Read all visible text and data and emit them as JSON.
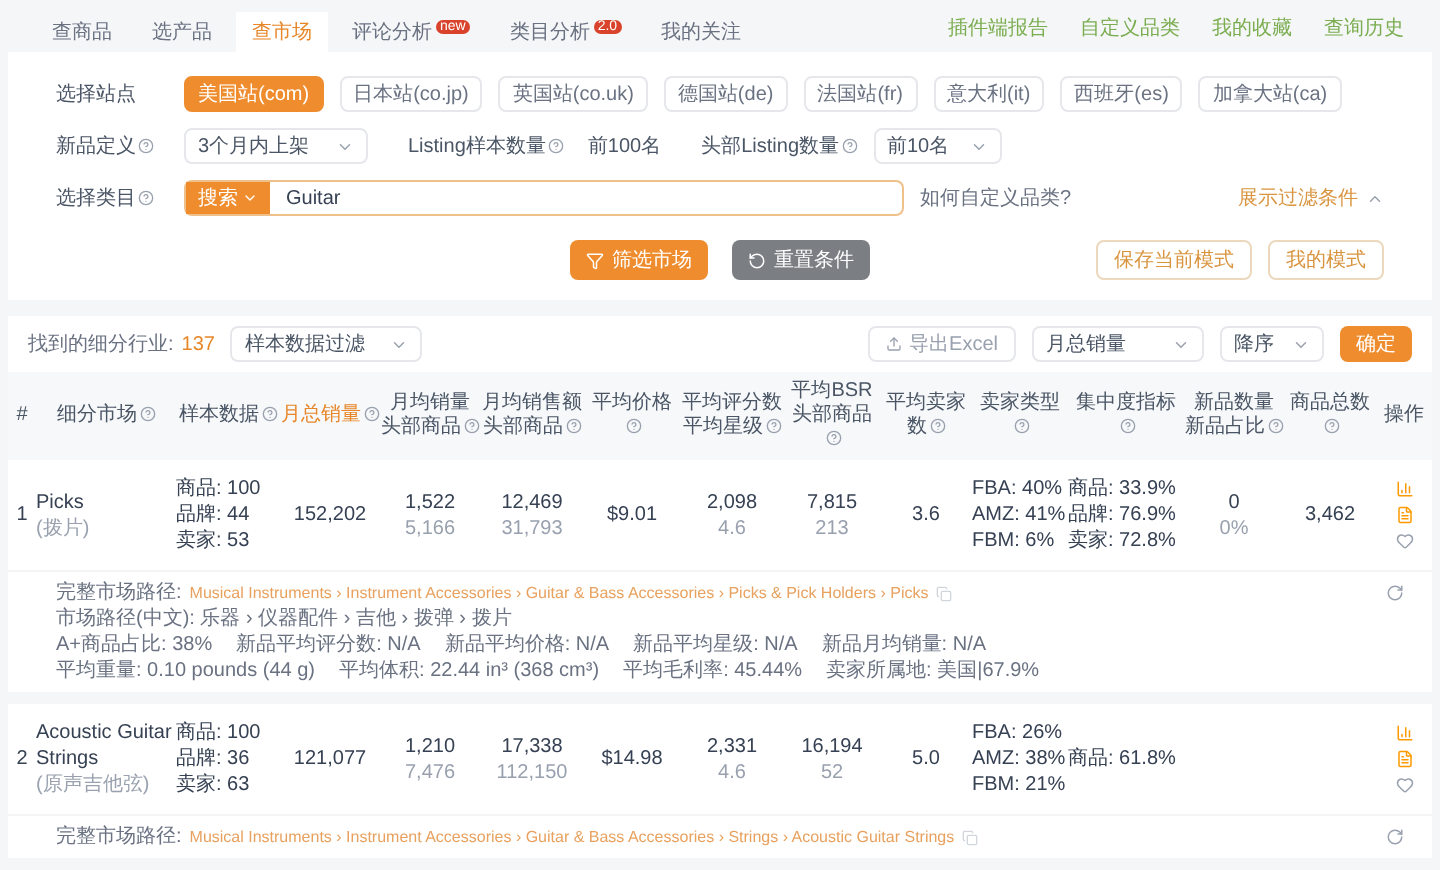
{
  "tabs": [
    {
      "label": "查商品",
      "selected": false
    },
    {
      "label": "选产品",
      "selected": false
    },
    {
      "label": "查市场",
      "selected": true
    },
    {
      "label": "评论分析",
      "selected": false,
      "badge": "new"
    },
    {
      "label": "类目分析",
      "selected": false,
      "badge": "2.0"
    },
    {
      "label": "我的关注",
      "selected": false
    }
  ],
  "top_links": [
    "插件端报告",
    "自定义品类",
    "我的收藏",
    "查询历史"
  ],
  "filters": {
    "site": {
      "label": "选择站点",
      "options": [
        {
          "label": "美国站(com)",
          "selected": true
        },
        {
          "label": "日本站(co.jp)",
          "selected": false
        },
        {
          "label": "英国站(co.uk)",
          "selected": false
        },
        {
          "label": "德国站(de)",
          "selected": false
        },
        {
          "label": "法国站(fr)",
          "selected": false
        },
        {
          "label": "意大利(it)",
          "selected": false
        },
        {
          "label": "西班牙(es)",
          "selected": false
        },
        {
          "label": "加拿大站(ca)",
          "selected": false
        }
      ]
    },
    "new_def": {
      "label": "新品定义",
      "value": "3个月内上架"
    },
    "sample": {
      "label": "Listing样本数量",
      "value": "前100名"
    },
    "head": {
      "label": "头部Listing数量",
      "value": "前10名"
    },
    "category": {
      "label": "选择类目",
      "mode": "搜索",
      "value": "Guitar",
      "help_link": "如何自定义品类?"
    },
    "toggle": {
      "label": "展示过滤条件",
      "expanded": true
    },
    "buttons": {
      "filter": "筛选市场",
      "reset": "重置条件",
      "save": "保存当前模式",
      "mine": "我的模式"
    }
  },
  "results": {
    "count_label": "找到的细分行业:",
    "count": "137",
    "sample_filter": "样本数据过滤",
    "export": "导出Excel",
    "sort_field": "月总销量",
    "sort_order": "降序",
    "confirm": "确定",
    "columns": [
      {
        "lines": [
          "#"
        ],
        "help": false,
        "sorted": false
      },
      {
        "lines": [
          "细分市场"
        ],
        "help": true,
        "sorted": false
      },
      {
        "lines": [
          "样本数据"
        ],
        "help": true,
        "sorted": false
      },
      {
        "lines": [
          "月总销量"
        ],
        "help": true,
        "sorted": true
      },
      {
        "lines": [
          "月均销量",
          "头部商品"
        ],
        "help": true,
        "sorted": false
      },
      {
        "lines": [
          "月均销售额",
          "头部商品"
        ],
        "help": true,
        "sorted": false
      },
      {
        "lines": [
          "平均价格"
        ],
        "help": true,
        "sorted": false
      },
      {
        "lines": [
          "平均评分数",
          "平均星级"
        ],
        "help": true,
        "sorted": false
      },
      {
        "lines": [
          "平均BSR",
          "头部商品"
        ],
        "help": true,
        "sorted": false
      },
      {
        "lines": [
          "平均卖家数"
        ],
        "help": true,
        "sorted": false
      },
      {
        "lines": [
          "卖家类型"
        ],
        "help": true,
        "sorted": false
      },
      {
        "lines": [
          "集中度指标"
        ],
        "help": true,
        "sorted": false
      },
      {
        "lines": [
          "新品数量",
          "新品占比"
        ],
        "help": true,
        "sorted": false
      },
      {
        "lines": [
          "商品总数"
        ],
        "help": true,
        "sorted": false
      },
      {
        "lines": [
          "操作"
        ],
        "help": false,
        "sorted": false
      }
    ],
    "rows": [
      {
        "index": "1",
        "name": "Picks",
        "name_cn": "(拨片)",
        "sample": [
          "商品: 100",
          "品牌: 44",
          "卖家: 53"
        ],
        "monthly_sales": "152,202",
        "avg_sales": {
          "main": "1,522",
          "sub": "5,166"
        },
        "avg_revenue": {
          "main": "12,469",
          "sub": "31,793"
        },
        "avg_price": "$9.01",
        "reviews": {
          "main": "2,098",
          "sub": "4.6"
        },
        "bsr": {
          "main": "7,815",
          "sub": "213"
        },
        "sellers": "3.6",
        "seller_types": [
          "FBA: 40%",
          "AMZ: 41%",
          "FBM: 6%"
        ],
        "concentration": [
          "商品: 33.9%",
          "品牌: 76.9%",
          "卖家: 72.8%"
        ],
        "new_items": {
          "main": "0",
          "sub": "0%"
        },
        "total": "3,462",
        "details": {
          "path_label": "完整市场路径:",
          "path": "Musical Instruments › Instrument Accessories › Guitar & Bass Accessories › Picks & Pick Holders › Picks",
          "lines": [
            [
              "市场路径(中文): 乐器 › 仪器配件 › 吉他 › 拨弹 › 拨片"
            ],
            [
              "A+商品占比: 38%",
              "新品平均评分数: N/A",
              "新品平均价格: N/A",
              "新品平均星级: N/A",
              "新品月均销量: N/A"
            ],
            [
              "平均重量: 0.10 pounds (44 g)",
              "平均体积: 22.44 in³ (368 cm³)",
              "平均毛利率: 45.44%",
              "卖家所属地: 美国|67.9%"
            ]
          ]
        }
      },
      {
        "index": "2",
        "name": "Acoustic Guitar Strings",
        "name_cn": "(原声吉他弦)",
        "sample": [
          "商品: 100",
          "品牌: 36",
          "卖家: 63"
        ],
        "monthly_sales": "121,077",
        "avg_sales": {
          "main": "1,210",
          "sub": "7,476"
        },
        "avg_revenue": {
          "main": "17,338",
          "sub": "112,150"
        },
        "avg_price": "$14.98",
        "reviews": {
          "main": "2,331",
          "sub": "4.6"
        },
        "bsr": {
          "main": "16,194",
          "sub": "52"
        },
        "sellers": "5.0",
        "seller_types": [
          "FBA: 26%",
          "AMZ: 38%",
          "FBM: 21%"
        ],
        "concentration": [
          "商品: 61.8%"
        ],
        "details": {
          "path_label": "完整市场路径:",
          "path": "Musical Instruments › Instrument Accessories › Guitar & Bass Accessories › Strings › Acoustic Guitar Strings"
        }
      }
    ]
  }
}
